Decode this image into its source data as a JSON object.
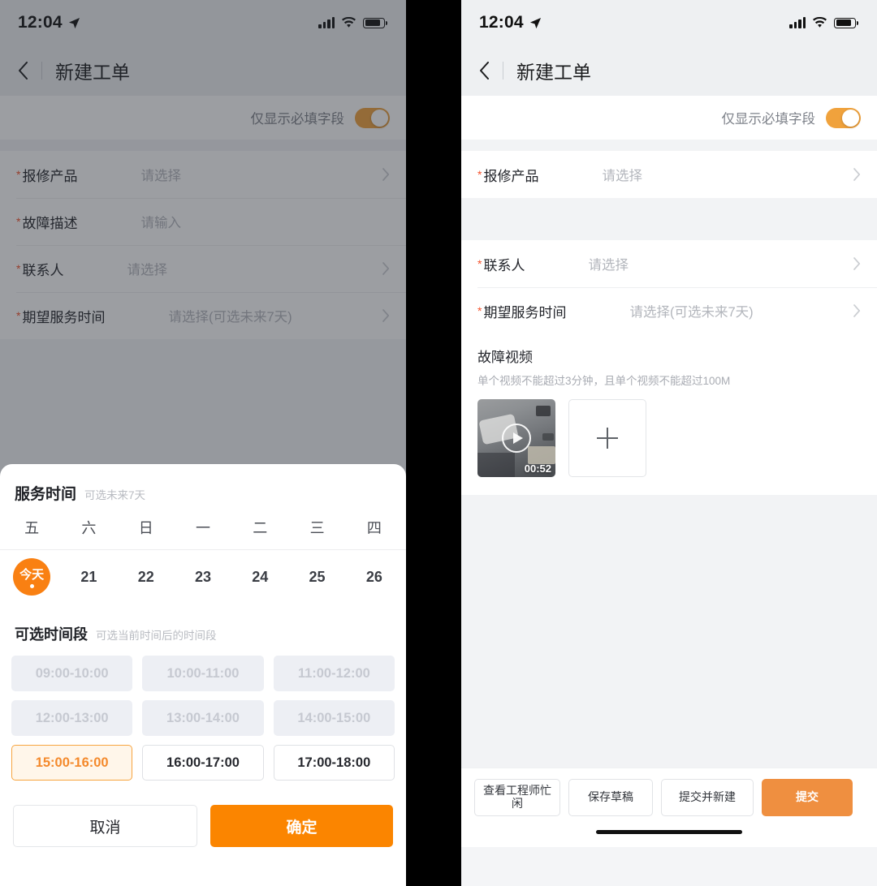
{
  "status_bar": {
    "time": "12:04",
    "location_icon": "location-arrow-icon",
    "signal_icon": "cellular-signal-icon",
    "wifi_icon": "wifi-icon",
    "battery_icon": "battery-icon"
  },
  "nav": {
    "back_icon": "chevron-left-icon",
    "title": "新建工单"
  },
  "required_toggle": {
    "label": "仅显示必填字段",
    "state": "on",
    "accent": "#f0a23c"
  },
  "left_phone": {
    "fields": [
      {
        "required": "*",
        "label": "报修产品",
        "value": "请选择",
        "chevron": true
      },
      {
        "required": "*",
        "label": "故障描述",
        "value": "请输入",
        "chevron": false
      },
      {
        "required": "*",
        "label": "联系人",
        "value": "请选择",
        "chevron": true
      },
      {
        "required": "*",
        "label": "期望服务时间",
        "value": "请选择(可选未来7天)",
        "chevron": true
      }
    ]
  },
  "right_phone": {
    "card_one": [
      {
        "required": "*",
        "label": "报修产品",
        "value": "请选择",
        "chevron": true
      }
    ],
    "card_two": [
      {
        "required": "*",
        "label": "联系人",
        "value": "请选择",
        "chevron": true
      },
      {
        "required": "*",
        "label": "期望服务时间",
        "value": "请选择(可选未来7天)",
        "chevron": true
      }
    ],
    "video": {
      "title": "故障视频",
      "hint": "单个视频不能超过3分钟，且单个视频不能超过100M",
      "thumb_duration": "00:52",
      "play_icon": "play-circle-icon",
      "add_icon": "plus-icon"
    },
    "actions": [
      {
        "label": "查看工程师忙闲",
        "style": "outline",
        "width": "w1"
      },
      {
        "label": "保存草稿",
        "style": "outline",
        "width": "w2"
      },
      {
        "label": "提交并新建",
        "style": "outline",
        "width": "w3"
      },
      {
        "label": "提交",
        "style": "primary",
        "width": "primary"
      }
    ]
  },
  "sheet": {
    "title": "服务时间",
    "subtitle": "可选未来7天",
    "weekdays": [
      "五",
      "六",
      "日",
      "一",
      "二",
      "三",
      "四"
    ],
    "dates": [
      {
        "label": "今天",
        "today": true
      },
      {
        "label": "21",
        "today": false
      },
      {
        "label": "22",
        "today": false
      },
      {
        "label": "23",
        "today": false
      },
      {
        "label": "24",
        "today": false
      },
      {
        "label": "25",
        "today": false
      },
      {
        "label": "26",
        "today": false
      }
    ],
    "slots_title": "可选时间段",
    "slots_subtitle": "可选当前时间后的时间段",
    "slots": [
      {
        "label": "09:00-10:00",
        "state": "disabled"
      },
      {
        "label": "10:00-11:00",
        "state": "disabled"
      },
      {
        "label": "11:00-12:00",
        "state": "disabled"
      },
      {
        "label": "12:00-13:00",
        "state": "disabled"
      },
      {
        "label": "13:00-14:00",
        "state": "disabled"
      },
      {
        "label": "14:00-15:00",
        "state": "disabled"
      },
      {
        "label": "15:00-16:00",
        "state": "selected"
      },
      {
        "label": "16:00-17:00",
        "state": "free"
      },
      {
        "label": "17:00-18:00",
        "state": "free"
      }
    ],
    "cancel_label": "取消",
    "confirm_label": "确定",
    "accent": "#fb8500"
  }
}
